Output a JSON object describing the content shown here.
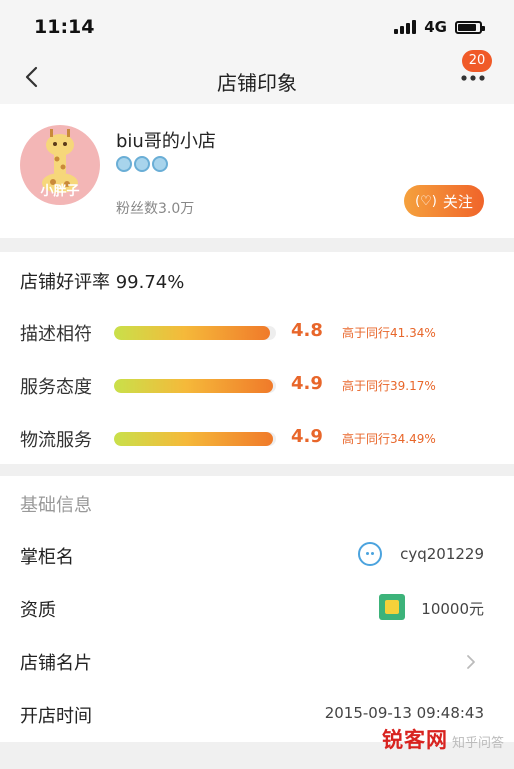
{
  "status_bar": {
    "time": "11:14",
    "network": "4G"
  },
  "nav": {
    "title": "店铺印象",
    "badge_count": "20",
    "icons": [
      "back-icon",
      "more-icon"
    ]
  },
  "shop": {
    "avatar_text": "小胖子",
    "name": "biu哥的小店",
    "fans": "粉丝数3.0万",
    "follow_label": "关注",
    "follow_icon": "(♡)",
    "level_icon_count": 3
  },
  "rating": {
    "overall": "店铺好评率 99.74%",
    "rows": [
      {
        "label": "描述相符",
        "score": "4.8",
        "compare": "高于同行41.34%",
        "fill": 0.96
      },
      {
        "label": "服务态度",
        "score": "4.9",
        "compare": "高于同行39.17%",
        "fill": 0.98
      },
      {
        "label": "物流服务",
        "score": "4.9",
        "compare": "高于同行34.49%",
        "fill": 0.98
      }
    ]
  },
  "basic_info": {
    "title": "基础信息",
    "rows": [
      {
        "label": "掌柜名",
        "value": "cyq201229",
        "icon": "wangwang-icon"
      },
      {
        "label": "资质",
        "value": "10000元",
        "icon": "deposit-icon"
      },
      {
        "label": "店铺名片",
        "value": "",
        "icon": "chevron-right-icon"
      },
      {
        "label": "开店时间",
        "value": "2015-09-13 09:48:43",
        "icon": ""
      }
    ]
  },
  "watermark": {
    "main": "锐客网",
    "sub": "知乎问答"
  },
  "colors": {
    "accent": "#f0642a",
    "score": "#e8662a",
    "background": "#f5f5f5"
  }
}
